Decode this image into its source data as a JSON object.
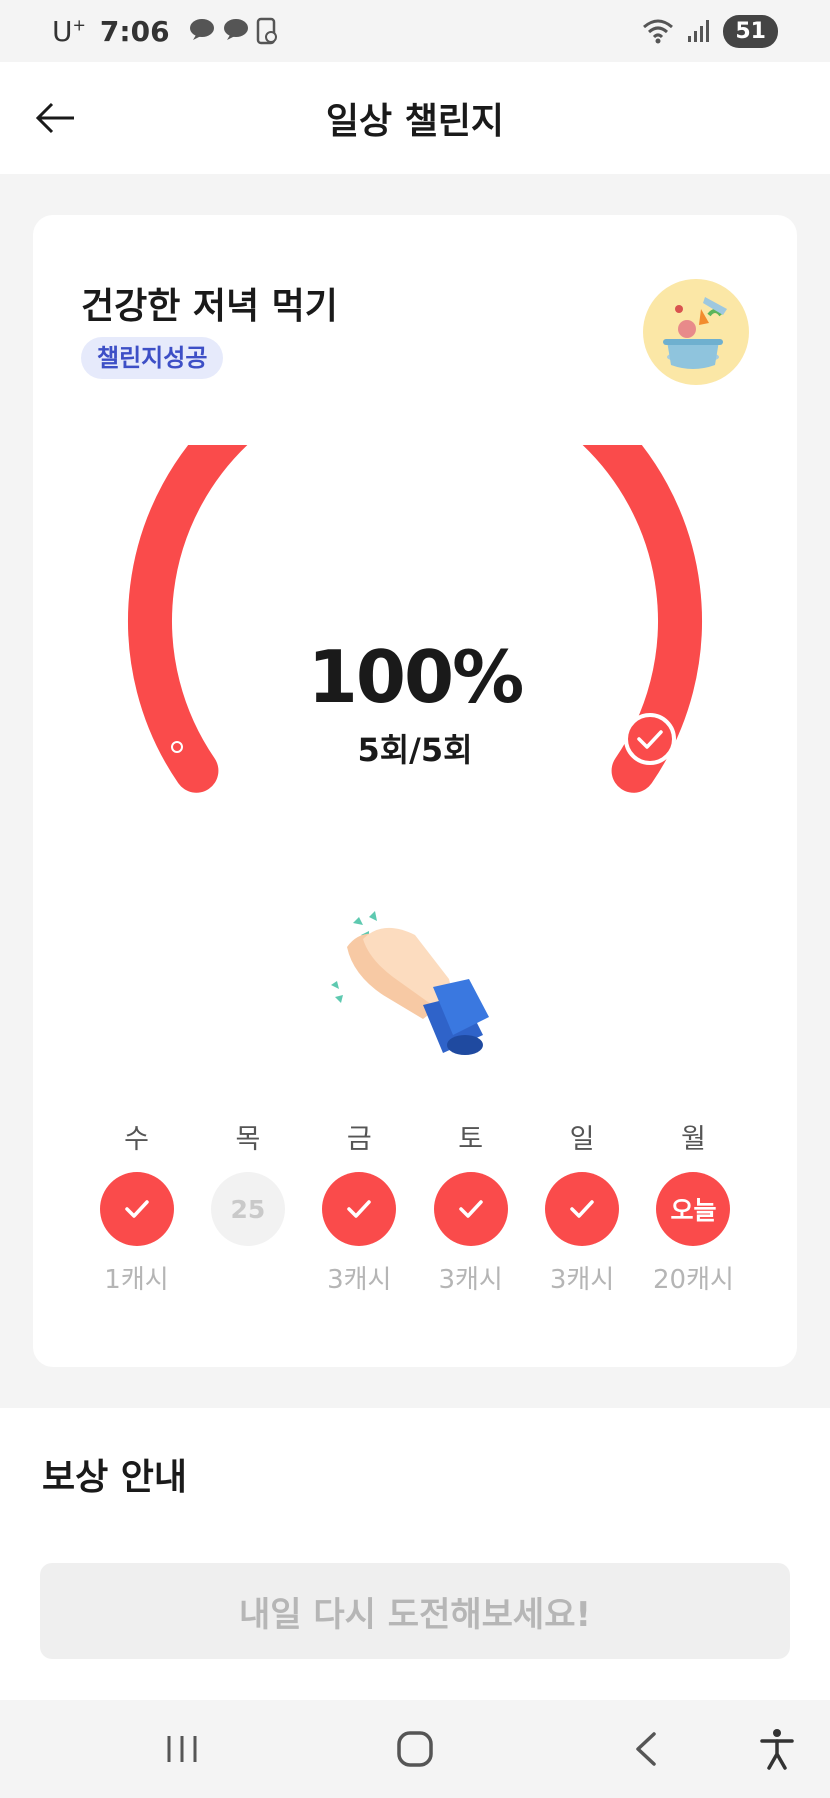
{
  "status_bar": {
    "carrier": "U",
    "carrier_sup": "+",
    "time": "7:06",
    "battery": "51"
  },
  "header": {
    "title": "일상 챌린지"
  },
  "challenge": {
    "title": "건강한 저녁 먹기",
    "badge": "챌린지성공",
    "percent": "100%",
    "count": "5회/5회",
    "progress": 1.0,
    "accent_color": "#fa4b4b"
  },
  "week": [
    {
      "day": "수",
      "status": "done",
      "label": "",
      "reward": "1캐시"
    },
    {
      "day": "목",
      "status": "missed",
      "label": "25",
      "reward": ""
    },
    {
      "day": "금",
      "status": "done",
      "label": "",
      "reward": "3캐시"
    },
    {
      "day": "토",
      "status": "done",
      "label": "",
      "reward": "3캐시"
    },
    {
      "day": "일",
      "status": "done",
      "label": "",
      "reward": "3캐시"
    },
    {
      "day": "월",
      "status": "today",
      "label": "오늘",
      "reward": "20캐시"
    }
  ],
  "reward": {
    "title": "보상 안내",
    "button_label": "내일 다시 도전해보세요!"
  },
  "icons": [
    "back-arrow-icon",
    "check-icon",
    "clapping-hands-icon",
    "food-pot-icon",
    "wifi-icon",
    "signal-icon",
    "recent-apps-icon",
    "home-icon",
    "back-nav-icon",
    "accessibility-icon"
  ]
}
